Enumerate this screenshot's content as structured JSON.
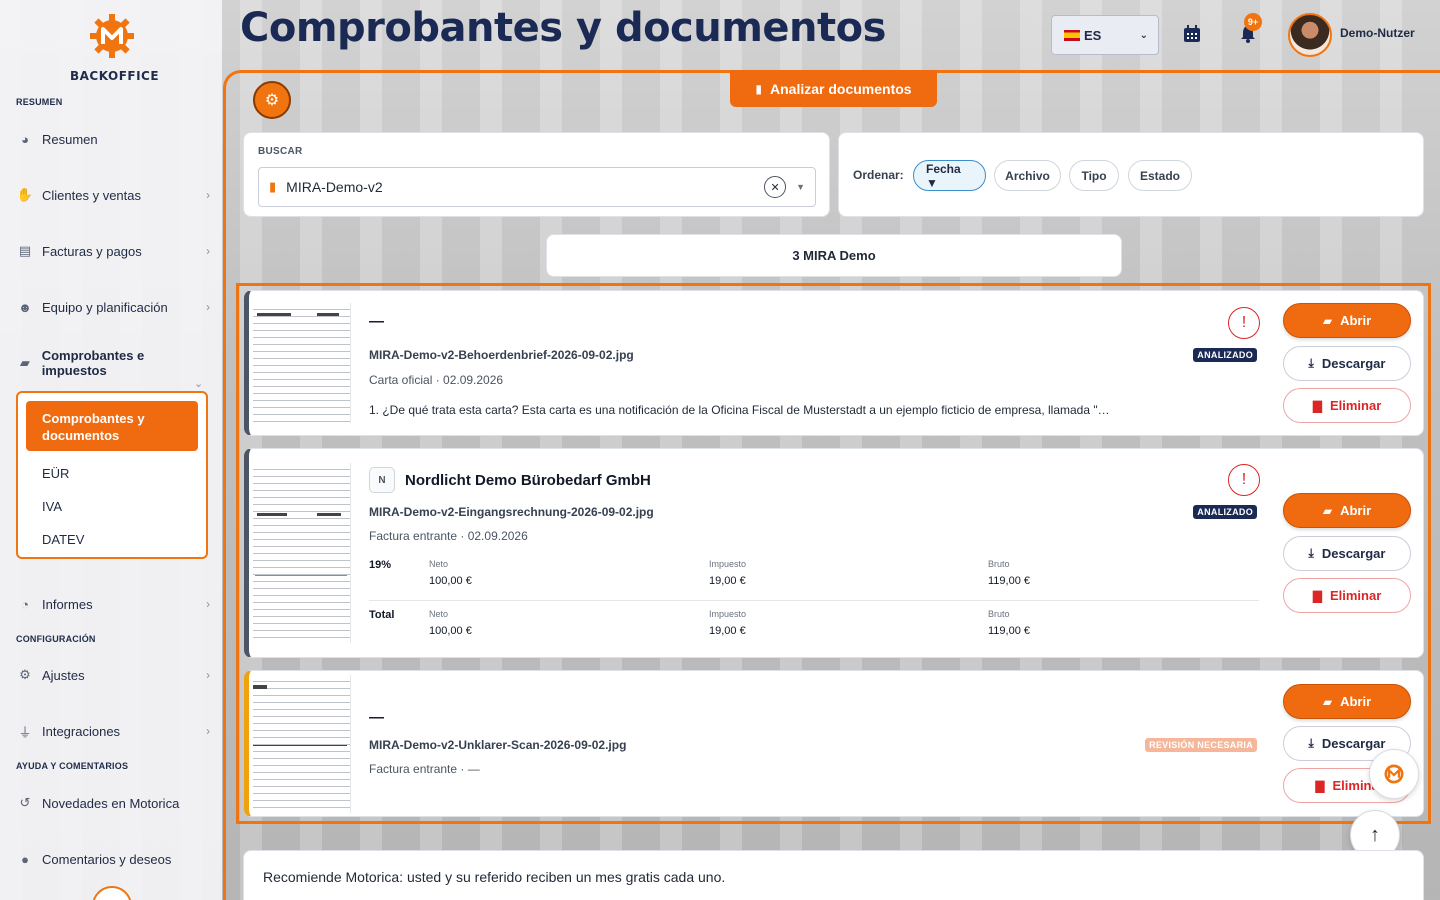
{
  "app": {
    "logo_text": "BACKOFFICE",
    "accent": "#f07410"
  },
  "sidebar": {
    "sections": {
      "resumen": "RESUMEN",
      "config": "CONFIGURACIÓN",
      "help": "AYUDA Y COMENTARIOS"
    },
    "items": [
      {
        "label": "Resumen",
        "icon": "gauge-icon"
      },
      {
        "label": "Clientes y ventas",
        "icon": "handshake-icon"
      },
      {
        "label": "Facturas y pagos",
        "icon": "invoice-icon"
      },
      {
        "label": "Equipo y planificación",
        "icon": "team-icon"
      },
      {
        "label": "Comprobantes e impuestos",
        "icon": "folder-icon"
      },
      {
        "label": "Informes",
        "icon": "pie-chart-icon"
      },
      {
        "label": "Ajustes",
        "icon": "gear-icon"
      },
      {
        "label": "Integraciones",
        "icon": "plug-icon"
      },
      {
        "label": "Novedades en Motorica",
        "icon": "history-icon"
      },
      {
        "label": "Comentarios y deseos",
        "icon": "lightbulb-icon"
      }
    ],
    "subitems": [
      "Comprobantes y documentos",
      "EÜR",
      "IVA",
      "DATEV"
    ]
  },
  "header": {
    "title": "Comprobantes y documentos",
    "language": "ES",
    "notifications": "9+",
    "user": "Demo-Nutzer"
  },
  "toolbar": {
    "analyze": "Analizar documentos"
  },
  "search": {
    "label": "BUSCAR",
    "value": "MIRA-Demo-v2"
  },
  "sort": {
    "label": "Ordenar:",
    "options": [
      "Fecha ▼",
      "Archivo",
      "Tipo",
      "Estado"
    ]
  },
  "count": "3 MIRA Demo",
  "documents": [
    {
      "vendor": "—",
      "filename": "MIRA-Demo-v2-Behoerdenbrief-2026-09-02.jpg",
      "meta": "Carta oficial · 02.09.2026",
      "status": "ANALIZADO",
      "description": "1. ¿De qué trata esta carta? Esta carta es una notificación de la Oficina Fiscal de Musterstadt a un ejemplo ficticio de empresa, llamada \"…"
    },
    {
      "vendor_initial": "N",
      "vendor": "Nordlicht Demo Bürobedarf GmbH",
      "filename": "MIRA-Demo-v2-Eingangsrechnung-2026-09-02.jpg",
      "meta": "Factura entrante · 02.09.2026",
      "status": "ANALIZADO",
      "rows": [
        {
          "label": "19%",
          "neto_l": "Neto",
          "neto": "100,00 €",
          "imp_l": "Impuesto",
          "imp": "19,00 €",
          "bruto_l": "Bruto",
          "bruto": "119,00 €"
        },
        {
          "label": "Total",
          "neto_l": "Neto",
          "neto": "100,00 €",
          "imp_l": "Impuesto",
          "imp": "19,00 €",
          "bruto_l": "Bruto",
          "bruto": "119,00 €"
        }
      ]
    },
    {
      "vendor": "—",
      "filename": "MIRA-Demo-v2-Unklarer-Scan-2026-09-02.jpg",
      "meta": "Factura entrante · —",
      "status": "REVISIÓN NECESARIA"
    }
  ],
  "actions": {
    "open": "Abrir",
    "download": "Descargar",
    "delete": "Eliminar",
    "delete_clipped": "Elimina"
  },
  "warn_mark": "!",
  "referral": "Recomiende Motorica: usted y su referido reciben un mes gratis cada uno."
}
